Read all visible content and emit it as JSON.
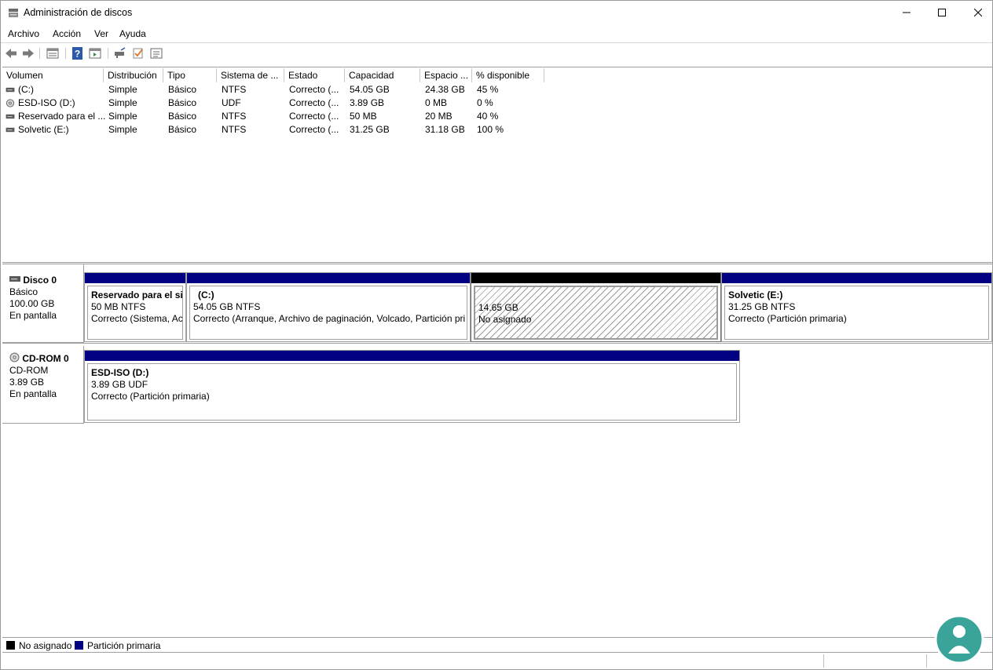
{
  "window": {
    "title": "Administración de discos"
  },
  "menu": [
    "Archivo",
    "Acción",
    "Ver",
    "Ayuda"
  ],
  "toolbar": {
    "icons": [
      "back-arrow-icon",
      "forward-arrow-icon",
      "disk-list-icon",
      "help-icon",
      "properties-pane-icon",
      "rescan-disks-icon",
      "check-icon",
      "settings-list-icon"
    ]
  },
  "columns": [
    "Volumen",
    "Distribución",
    "Tipo",
    "Sistema de ...",
    "Estado",
    "Capacidad",
    "Espacio ...",
    "% disponible"
  ],
  "volumes": [
    {
      "name": "(C:)",
      "layout": "Simple",
      "type": "Básico",
      "fs": "NTFS",
      "status": "Correcto (...",
      "capacity": "54.05 GB",
      "free": "24.38 GB",
      "pct": "45 %",
      "icon": "drive-icon"
    },
    {
      "name": "ESD-ISO (D:)",
      "layout": "Simple",
      "type": "Básico",
      "fs": "UDF",
      "status": "Correcto (...",
      "capacity": "3.89 GB",
      "free": "0 MB",
      "pct": "0 %",
      "icon": "cdrom-icon"
    },
    {
      "name": "Reservado para el ...",
      "layout": "Simple",
      "type": "Básico",
      "fs": "NTFS",
      "status": "Correcto (...",
      "capacity": "50 MB",
      "free": "20 MB",
      "pct": "40 %",
      "icon": "drive-icon"
    },
    {
      "name": "Solvetic (E:)",
      "layout": "Simple",
      "type": "Básico",
      "fs": "NTFS",
      "status": "Correcto (...",
      "capacity": "31.25 GB",
      "free": "31.18 GB",
      "pct": "100 %",
      "icon": "drive-icon"
    }
  ],
  "disks": [
    {
      "name": "Disco 0",
      "kind": "Básico",
      "size": "100.00 GB",
      "state": "En pantalla",
      "partitions": [
        {
          "name": "Reservado para el sis",
          "size": "50 MB NTFS",
          "status": "Correcto (Sistema, Ac"
        },
        {
          "name": "(C:)",
          "size": "54.05 GB NTFS",
          "status": "Correcto (Arranque, Archivo de paginación, Volcado, Partición pri"
        },
        {
          "name": "",
          "size": "14.65 GB",
          "status": "No asignado"
        },
        {
          "name": "Solvetic  (E:)",
          "size": "31.25 GB NTFS",
          "status": "Correcto (Partición primaria)"
        }
      ]
    },
    {
      "name": "CD-ROM 0",
      "kind": "CD-ROM",
      "size": "3.89 GB",
      "state": "En pantalla",
      "partitions": [
        {
          "name": "ESD-ISO  (D:)",
          "size": "3.89 GB UDF",
          "status": "Correcto (Partición primaria)"
        }
      ]
    }
  ],
  "legend": [
    {
      "label": "No asignado",
      "color": "#000000"
    },
    {
      "label": "Partición primaria",
      "color": "#000080"
    }
  ],
  "colors": {
    "primary_partition": "#000080",
    "unallocated": "#000000",
    "logo": "#3aa39a"
  }
}
